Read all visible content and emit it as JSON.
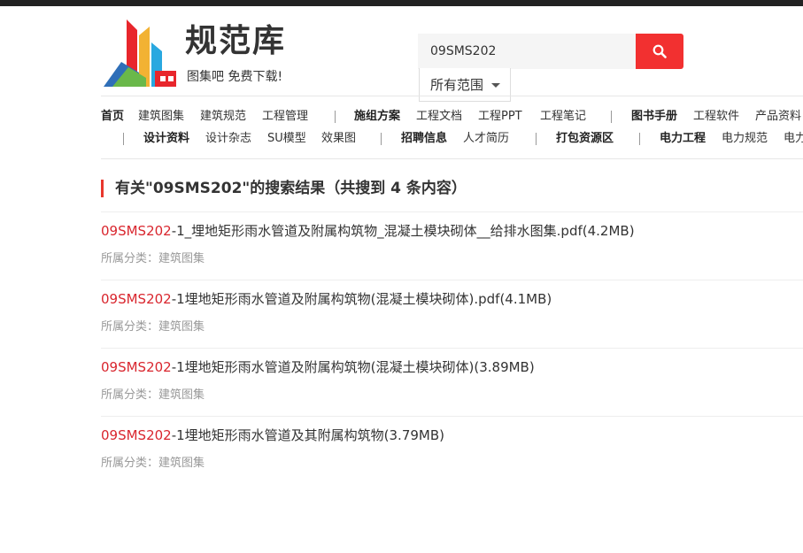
{
  "logo": {
    "title": "规范库",
    "slogan": "图集吧  免费下载!"
  },
  "search": {
    "value": "09SMS202",
    "scope": "所有范围"
  },
  "nav": {
    "row1": [
      {
        "label": "首页",
        "bold": true
      },
      {
        "label": "建筑图集"
      },
      {
        "label": "建筑规范"
      },
      {
        "label": "工程管理"
      },
      {
        "sep": true
      },
      {
        "label": "施组方案",
        "bold": true
      },
      {
        "label": "工程文档"
      },
      {
        "label": "工程PPT"
      },
      {
        "label": "工程笔记"
      },
      {
        "sep": true
      },
      {
        "label": "图书手册",
        "bold": true
      },
      {
        "label": "工程软件"
      },
      {
        "label": "产品资料"
      }
    ],
    "row2": [
      {
        "sep": true
      },
      {
        "label": "设计资料",
        "bold": true
      },
      {
        "label": "设计杂志"
      },
      {
        "label": "SU模型"
      },
      {
        "label": "效果图"
      },
      {
        "sep": true
      },
      {
        "label": "招聘信息",
        "bold": true
      },
      {
        "label": "人才简历"
      },
      {
        "sep": true
      },
      {
        "label": "打包资源区",
        "bold": true
      },
      {
        "sep": true
      },
      {
        "label": "电力工程",
        "bold": true
      },
      {
        "label": "电力规范"
      },
      {
        "label": "电力"
      }
    ]
  },
  "results": {
    "heading": "有关\"09SMS202\"的搜索结果（共搜到 4 条内容）",
    "items": [
      {
        "highlight": "09SMS202",
        "rest": "-1_埋地矩形雨水管道及附属构筑物_混凝土模块砌体__给排水图集.pdf(4.2MB)",
        "category": "所属分类：建筑图集"
      },
      {
        "highlight": "09SMS202",
        "rest": "-1埋地矩形雨水管道及附属构筑物(混凝土模块砌体).pdf(4.1MB)",
        "category": "所属分类：建筑图集"
      },
      {
        "highlight": "09SMS202",
        "rest": "-1埋地矩形雨水管道及附属构筑物(混凝土模块砌体)(3.89MB)",
        "category": "所属分类：建筑图集"
      },
      {
        "highlight": "09SMS202",
        "rest": "-1埋地矩形雨水管道及其附属构筑物(3.79MB)",
        "category": "所属分类：建筑图集"
      }
    ]
  },
  "colors": {
    "accent": "#f23030",
    "highlight": "#d9262e"
  }
}
